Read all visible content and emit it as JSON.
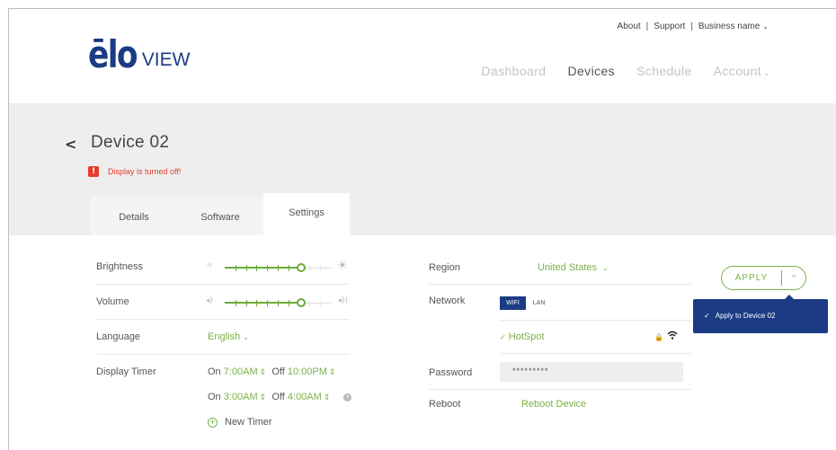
{
  "brand": {
    "logo_main": "ēlo",
    "logo_sub": "VIEW",
    "accent_green": "#7ab24a",
    "brand_blue": "#1b3c84",
    "alert_red": "#e53b2e"
  },
  "toplinks": {
    "about": "About",
    "support": "Support",
    "business": "Business name",
    "sep": "|"
  },
  "nav": {
    "dashboard": "Dashboard",
    "devices": "Devices",
    "schedule": "Schedule",
    "account": "Account"
  },
  "device": {
    "title": "Device 02",
    "alert": "Display is turned off!"
  },
  "tabs": {
    "details": "Details",
    "software": "Software",
    "settings": "Settings",
    "active": "Settings"
  },
  "settings": {
    "brightness": {
      "label": "Brightness",
      "level_fraction": 0.72
    },
    "volume": {
      "label": "Volume",
      "level_fraction": 0.72
    },
    "language": {
      "label": "Language",
      "value": "English"
    },
    "display_timer": {
      "label": "Display Timer",
      "timers": [
        {
          "on_label": "On",
          "on_time": "7:00AM",
          "off_label": "Off",
          "off_time": "10:00PM"
        },
        {
          "on_label": "On",
          "on_time": "3:00AM",
          "off_label": "Off",
          "off_time": "4:00AM"
        }
      ],
      "new_timer": "New Timer"
    },
    "region": {
      "label": "Region",
      "value": "United States"
    },
    "network": {
      "label": "Network",
      "wifi": "WIFI",
      "lan": "LAN",
      "selected": "WIFI",
      "ssid": "HotSpot"
    },
    "password": {
      "label": "Password",
      "value": "*********"
    },
    "reboot": {
      "label": "Reboot",
      "action": "Reboot Device"
    }
  },
  "apply": {
    "label": "APPLY",
    "menu_item": "Apply to Device 02"
  }
}
